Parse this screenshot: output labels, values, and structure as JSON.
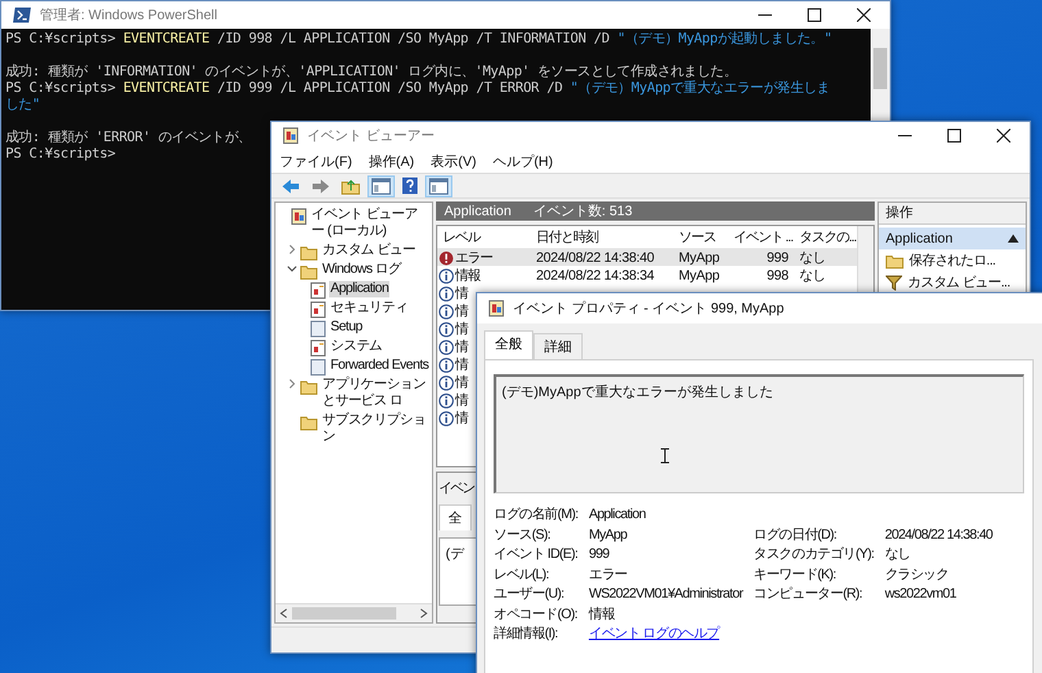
{
  "powershell": {
    "title": "管理者: Windows PowerShell",
    "lines": [
      {
        "spaced": false,
        "segments": [
          {
            "kind": "plain",
            "text": "PS C:¥scripts> "
          },
          {
            "kind": "command",
            "text": "EVENTCREATE"
          },
          {
            "kind": "plain",
            "text": " /ID 998 /L APPLICATION /SO MyApp /T INFORMATION /D "
          },
          {
            "kind": "string",
            "text": "\"（デモ）MyAppが起動しました。\""
          }
        ]
      },
      {
        "spaced": true,
        "segments": [
          {
            "kind": "plain",
            "text": "成功: 種類が 'INFORMATION' のイベントが、'APPLICATION' ログ内に、'MyApp' をソースとして作成されました。"
          }
        ]
      },
      {
        "spaced": false,
        "segments": [
          {
            "kind": "plain",
            "text": "PS C:¥scripts> "
          },
          {
            "kind": "command",
            "text": "EVENTCREATE"
          },
          {
            "kind": "plain",
            "text": " /ID 999 /L APPLICATION /SO MyApp /T ERROR /D "
          },
          {
            "kind": "string",
            "text": "\"（デモ）MyAppで重大なエラーが発生しま"
          }
        ]
      },
      {
        "spaced": false,
        "segments": [
          {
            "kind": "string",
            "text": "した\""
          }
        ]
      },
      {
        "spaced": true,
        "segments": [
          {
            "kind": "plain",
            "text": "成功: 種類が 'ERROR' のイベントが、"
          }
        ]
      },
      {
        "spaced": false,
        "segments": [
          {
            "kind": "plain",
            "text": "PS C:¥scripts>"
          }
        ]
      }
    ]
  },
  "event_viewer": {
    "title": "イベント ビューアー",
    "menu": [
      "ファイル(F)",
      "操作(A)",
      "表示(V)",
      "ヘルプ(H)"
    ],
    "toolbar": [
      {
        "kind": "back",
        "on": false
      },
      {
        "kind": "forward",
        "on": false
      },
      {
        "kind": "folder",
        "on": false
      },
      {
        "kind": "panel",
        "on": true
      },
      {
        "kind": "help",
        "on": false
      },
      {
        "kind": "panel",
        "on": true
      }
    ],
    "tree": [
      {
        "label": "イベント ビューアー (ローカル)",
        "kind": "viewer",
        "selected": false,
        "children": [
          {
            "label": "カスタム ビュー",
            "kind": "folder",
            "expanded": false,
            "selected": false
          },
          {
            "label": "Windows ログ",
            "kind": "folder",
            "expanded": true,
            "selected": false,
            "children": [
              {
                "label": "Application",
                "kind": "log",
                "selected": true
              },
              {
                "label": "セキュリティ",
                "kind": "log",
                "selected": false
              },
              {
                "label": "Setup",
                "kind": "plainlog",
                "selected": false
              },
              {
                "label": "システム",
                "kind": "log",
                "selected": false
              },
              {
                "label": "Forwarded Events",
                "kind": "plainlog",
                "selected": false
              }
            ]
          },
          {
            "label": "アプリケーションとサービス ロ",
            "kind": "folder",
            "expanded": false,
            "selected": false
          },
          {
            "label": "サブスクリプション",
            "kind": "folder",
            "selected": false
          }
        ]
      }
    ],
    "list_header": {
      "name": "Application",
      "count": "イベント数: 513"
    },
    "columns": [
      "レベル",
      "日付と時刻",
      "ソース",
      "イベント ...",
      "タスクの..."
    ],
    "rows": [
      {
        "kind": "error",
        "selected": true,
        "cells": [
          "エラー",
          "2024/08/22 14:38:40",
          "MyApp",
          "999",
          "なし"
        ]
      },
      {
        "kind": "info",
        "selected": false,
        "cells": [
          "情報",
          "2024/08/22 14:38:34",
          "MyApp",
          "998",
          "なし"
        ]
      },
      {
        "kind": "info",
        "selected": false,
        "cells": [
          "情"
        ]
      },
      {
        "kind": "info",
        "selected": false,
        "cells": [
          "情"
        ]
      },
      {
        "kind": "info",
        "selected": false,
        "cells": [
          "情"
        ]
      },
      {
        "kind": "info",
        "selected": false,
        "cells": [
          "情"
        ]
      },
      {
        "kind": "info",
        "selected": false,
        "cells": [
          "情"
        ]
      },
      {
        "kind": "info",
        "selected": false,
        "cells": [
          "情"
        ]
      },
      {
        "kind": "info",
        "selected": false,
        "cells": [
          "情"
        ]
      },
      {
        "kind": "info",
        "selected": false,
        "cells": [
          "情"
        ]
      }
    ],
    "preview": {
      "title": "イベン",
      "tab": "全",
      "text": "(デ"
    },
    "actions": {
      "title": "操作",
      "section": "Application",
      "items": [
        {
          "kind": "folder",
          "label": "保存されたロ..."
        },
        {
          "kind": "filter",
          "label": "カスタム ビュー..."
        }
      ]
    }
  },
  "dialog": {
    "title": "イベント プロパティ - イベント 999, MyApp",
    "tabs": [
      {
        "label": "全般",
        "selected": true
      },
      {
        "label": "詳細",
        "selected": false
      }
    ],
    "message": "(デモ)MyAppで重大なエラーが発生しました",
    "fields": [
      {
        "label": "ログの名前(M):",
        "value": "Application",
        "kind": "text"
      },
      {
        "label": "ソース(S):",
        "value": "MyApp",
        "kind": "text",
        "right_label": "ログの日付(D):",
        "right_value": "2024/08/22 14:38:40"
      },
      {
        "label": "イベント ID(E):",
        "value": "999",
        "kind": "text",
        "right_label": "タスクのカテゴリ(Y):",
        "right_value": "なし"
      },
      {
        "label": "レベル(L):",
        "value": "エラー",
        "kind": "text",
        "right_label": "キーワード(K):",
        "right_value": "クラシック"
      },
      {
        "label": "ユーザー(U):",
        "value": "WS2022VM01¥Administrator",
        "kind": "text",
        "right_label": "コンピューター(R):",
        "right_value": "ws2022vm01"
      },
      {
        "label": "オペコード(O):",
        "value": "情報",
        "kind": "text"
      },
      {
        "label": "詳細情報(I):",
        "value": "イベント ログのヘルプ",
        "kind": "link"
      }
    ]
  }
}
